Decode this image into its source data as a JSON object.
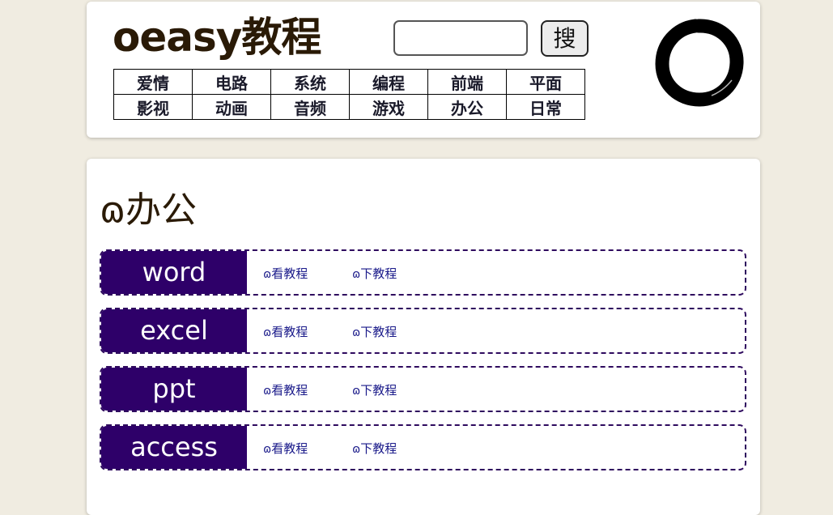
{
  "header": {
    "site_title": "oeasy教程",
    "search": {
      "placeholder": "",
      "value": "",
      "button_label": "搜"
    },
    "nav_rows": [
      [
        "爱情",
        "电路",
        "系统",
        "编程",
        "前端",
        "平面"
      ],
      [
        "影视",
        "动画",
        "音频",
        "游戏",
        "办公",
        "日常"
      ]
    ],
    "logo_icon": "enso-circle-icon"
  },
  "main": {
    "heading_icon": "ɷ",
    "heading": "办公",
    "courses": [
      {
        "name": "word",
        "watch_label": "看教程",
        "download_label": "下教程"
      },
      {
        "name": "excel",
        "watch_label": "看教程",
        "download_label": "下教程"
      },
      {
        "name": "ppt",
        "watch_label": "看教程",
        "download_label": "下教程"
      },
      {
        "name": "access",
        "watch_label": "看教程",
        "download_label": "下教程"
      }
    ],
    "link_icon": "ɷ"
  },
  "colors": {
    "background": "#f0ece1",
    "course_label_bg": "#2e0069",
    "link": "#1a1a8a",
    "title": "#2a1a06"
  }
}
